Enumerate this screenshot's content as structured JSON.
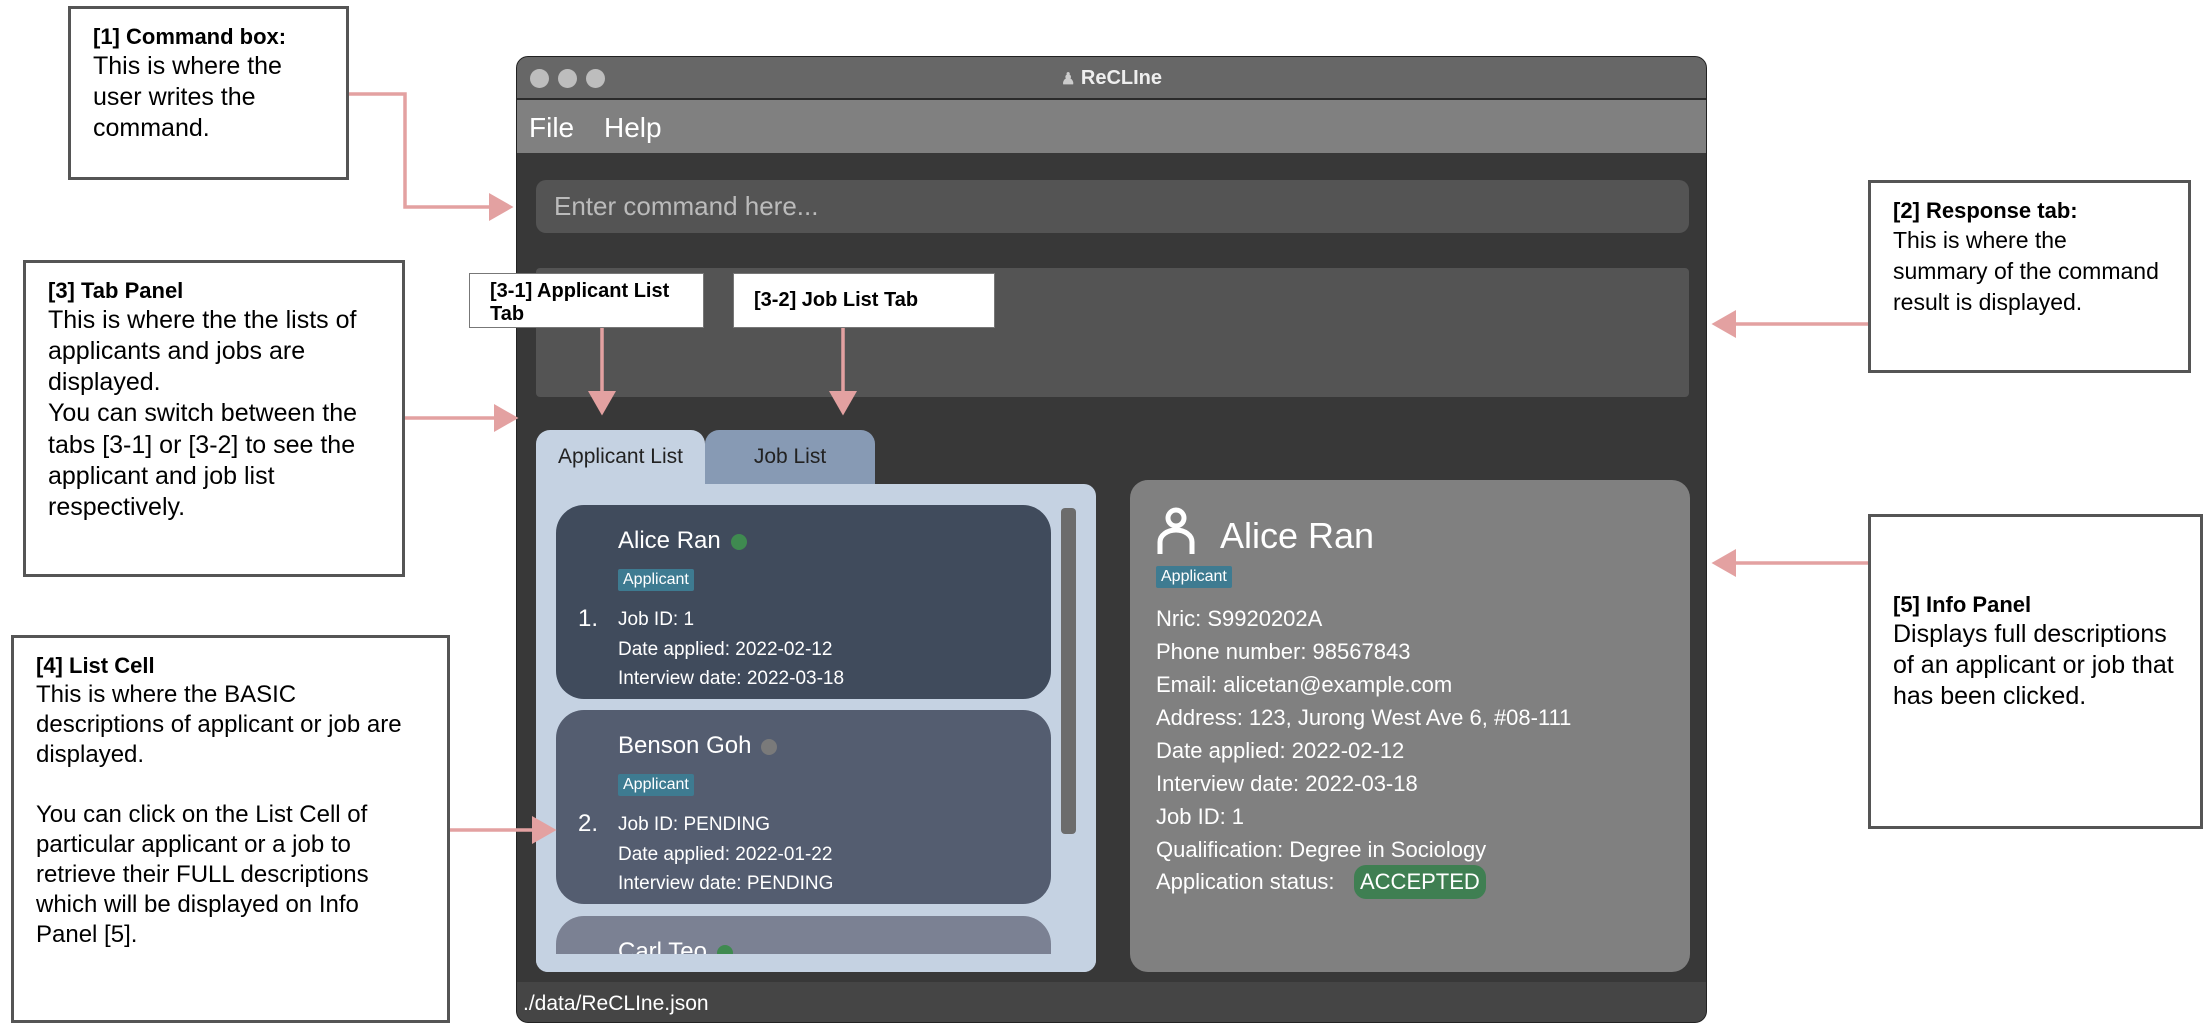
{
  "window": {
    "title": "ReCLIne",
    "title_icon": "people-hierarchy-icon"
  },
  "menu": {
    "file": "File",
    "help": "Help"
  },
  "command_box": {
    "placeholder": "Enter command here...",
    "value": ""
  },
  "response": {
    "text": ""
  },
  "tabs": [
    {
      "label": "Applicant List",
      "active": true
    },
    {
      "label": "Job List",
      "active": false
    }
  ],
  "list": [
    {
      "index": "1.",
      "name": "Alice Ran",
      "status_color": "#3f8a50",
      "badge": "Applicant",
      "job_id": "Job ID: 1",
      "date_applied": "Date applied: 2022-02-12",
      "interview_date": "Interview date: 2022-03-18"
    },
    {
      "index": "2.",
      "name": "Benson Goh",
      "status_color": "#7a7a7a",
      "badge": "Applicant",
      "job_id": "Job ID: PENDING",
      "date_applied": "Date applied: 2022-01-22",
      "interview_date": "Interview date: PENDING"
    },
    {
      "name": "Carl Teo",
      "status_color": "#3f8a50"
    }
  ],
  "info": {
    "name": "Alice Ran",
    "icon": "person-icon",
    "badge": "Applicant",
    "rows": [
      "Nric:  S9920202A",
      "Phone number:  98567843",
      "Email:  alicetan@example.com",
      "Address:  123, Jurong West Ave 6, #08-111",
      "Date applied:  2022-02-12",
      "Interview date:  2022-03-18",
      "Job ID:  1",
      "Qualification:  Degree in Sociology"
    ],
    "status_label": "Application status:",
    "status_value": "ACCEPTED",
    "status_color": "#3f7f52"
  },
  "status_bar": {
    "path": "./data/ReCLIne.json"
  },
  "annotations": {
    "a1": {
      "title": "[1] Command box:",
      "body": "This is where the user writes the command."
    },
    "a2": {
      "title": "[2] Response tab:",
      "body": "This is where the summary of the command result is displayed."
    },
    "a3": {
      "title": "[3] Tab Panel",
      "body": "This is where the the lists of applicants and jobs are displayed.\nYou can switch between the tabs [3-1] or [3-2] to see the applicant and job list respectively."
    },
    "a31": {
      "title": "[3-1] Applicant List Tab"
    },
    "a32": {
      "title": "[3-2] Job List Tab"
    },
    "a4": {
      "title": "[4] List Cell",
      "body": "This is where the BASIC descriptions of applicant or job are displayed.\n\nYou can click on the List Cell of particular applicant or a job to retrieve their FULL descriptions which will be displayed on Info Panel [5]."
    },
    "a5": {
      "title": "[5] Info Panel",
      "body": "Displays full descriptions of an applicant or job that has been clicked."
    }
  },
  "colors": {
    "arrow": "#e3a1a1",
    "tab_active": "#c5d2e2",
    "tab_inactive": "#879ab4"
  }
}
